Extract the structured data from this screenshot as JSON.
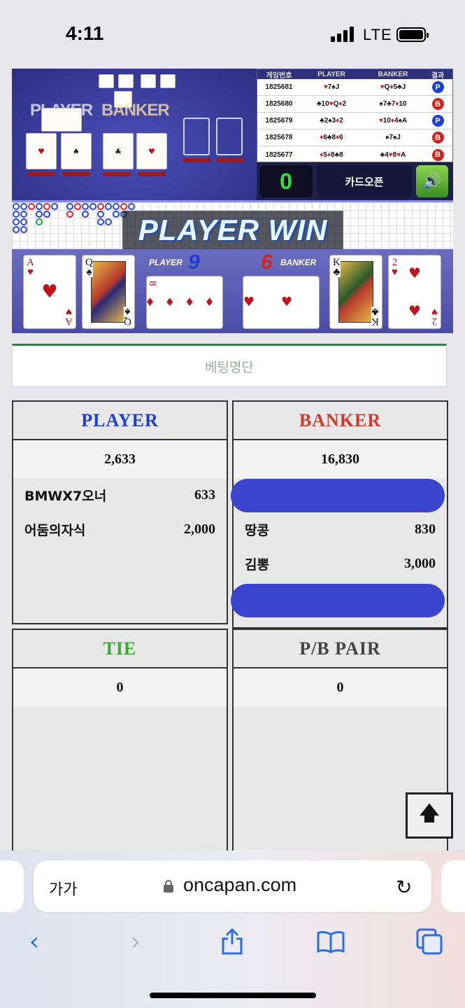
{
  "status": {
    "time": "4:11",
    "network": "LTE"
  },
  "game": {
    "felt_player": "PLAYER",
    "felt_banker": "BANKER",
    "results_header": [
      "게임번호",
      "PLAYER",
      "BANKER",
      "결과"
    ],
    "results": [
      {
        "id": "1825681",
        "player": "♥7♠J",
        "banker": "♥Q♦5♣J",
        "result": "P"
      },
      {
        "id": "1825680",
        "player": "♣10♥Q♦2",
        "banker": "♠7♣7♦10",
        "result": "B"
      },
      {
        "id": "1825679",
        "player": "♣2♠3♦2",
        "banker": "♥10♦4♠A",
        "result": "P"
      },
      {
        "id": "1825678",
        "player": "♦6♣8♦6",
        "banker": "♠7♠J",
        "result": "B"
      },
      {
        "id": "1825677",
        "player": "♦5♦8♣8",
        "banker": "♣4♥8♥A",
        "result": "B"
      }
    ],
    "counter": "0",
    "card_open_label": "카드오픈",
    "win_text": "PLAYER WIN",
    "player_label": "PLAYER",
    "player_score": "9",
    "banker_label": "BANKER",
    "banker_score": "6",
    "player_cards": [
      "A♥",
      "Q♠",
      "8♦"
    ],
    "banker_cards": [
      "4♥",
      "K♣",
      "2♥"
    ]
  },
  "bet_list_title": "베팅명단",
  "panels": {
    "player": {
      "title": "PLAYER",
      "total": "2,633",
      "rows": [
        {
          "name": "BMWX7오너",
          "amount": "633"
        },
        {
          "name": "어둠의자식",
          "amount": "2,000"
        }
      ]
    },
    "banker": {
      "title": "BANKER",
      "total": "16,830",
      "rows": [
        {
          "name": "땅콩",
          "amount": "830"
        },
        {
          "name": "김뽕",
          "amount": "3,000"
        }
      ]
    },
    "tie": {
      "title": "TIE",
      "total": "0"
    },
    "pair": {
      "title": "P/B PAIR",
      "total": "0"
    }
  },
  "browser": {
    "text_size": "가가",
    "url": "oncapan.com"
  },
  "colors": {
    "player": "#1b3fd4",
    "banker": "#d23a2e",
    "tie": "#3fa834",
    "pair": "#444444",
    "accent_green": "#1f8a3a",
    "redaction": "#3a44cc"
  }
}
